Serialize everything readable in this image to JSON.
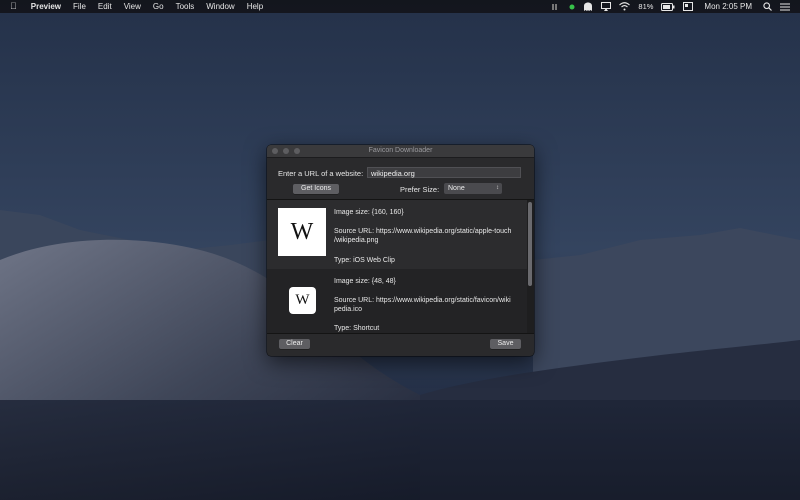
{
  "menubar": {
    "apple_icon": "apple-icon",
    "app_name": "Preview",
    "menus": [
      "File",
      "Edit",
      "View",
      "Go",
      "Tools",
      "Window",
      "Help"
    ],
    "battery_percent": "81%",
    "clock": "Mon 2:05 PM"
  },
  "window": {
    "title": "Favicon Downloader",
    "url_label": "Enter a URL of a website:",
    "url_value": "wikipedia.org",
    "get_icons_label": "Get Icons",
    "prefer_size_label": "Prefer Size:",
    "prefer_size_value": "None",
    "clear_label": "Clear",
    "save_label": "Save",
    "results": [
      {
        "thumb_letter": "W",
        "image_size": "Image size: {160, 160}",
        "source_line1": "Source URL: https://www.wikipedia.org/static/apple-touch",
        "source_line2": "/wikipedia.png",
        "type": "Type: iOS Web Clip"
      },
      {
        "thumb_letter": "W",
        "image_size": "Image size: {48, 48}",
        "source_line1": "Source URL: https://www.wikipedia.org/static/favicon/wiki",
        "source_line2": "pedia.ico",
        "type": "Type: Shortcut"
      }
    ]
  },
  "colors": {
    "menubar_bg": "#12141a",
    "window_bg": "#2a2a2c",
    "list_bg": "#1e1e1f",
    "button_bg": "#5e5e62"
  }
}
